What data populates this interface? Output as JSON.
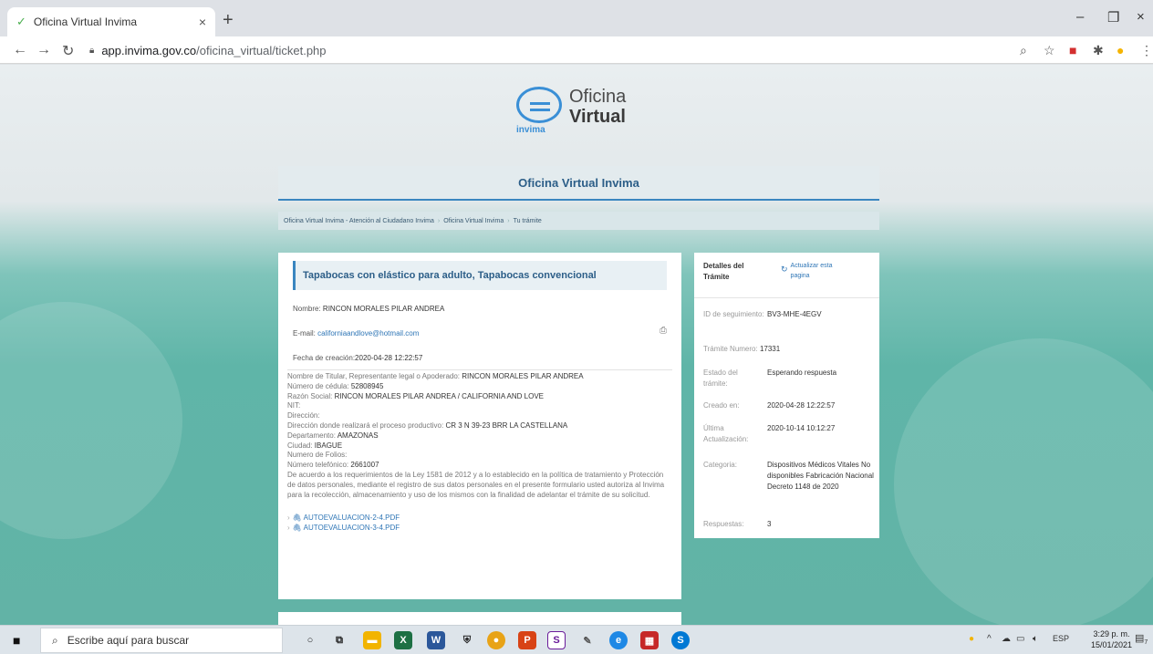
{
  "browser": {
    "tab_title": "Oficina Virtual Invima",
    "url_host": "app.invima.gov.co",
    "url_path": "/oficina_virtual/ticket.php"
  },
  "logo": {
    "brand": "invima",
    "line1": "Oficina",
    "line2": "Virtual"
  },
  "header": {
    "title": "Oficina Virtual Invima"
  },
  "breadcrumb": [
    "Oficina Virtual Invima - Atención al Ciudadano Invima",
    "Oficina Virtual Invima",
    "Tu trámite"
  ],
  "ticket": {
    "title": "Tapabocas con elástico para adulto, Tapabocas convencional",
    "nombre_label": "Nombre:",
    "nombre_value": "RINCON MORALES PILAR ANDREA",
    "email_label": "E-mail:",
    "email_value": "californiaandlove@hotmail.com",
    "fecha_label": "Fecha de creación:",
    "fecha_value": "2020-04-28 12:22:57",
    "details": [
      {
        "label": "Nombre de Titular, Representante legal o Apoderado: ",
        "value": "RINCON MORALES PILAR ANDREA"
      },
      {
        "label": "Número de cédula: ",
        "value": "52808945"
      },
      {
        "label": "Razón Social: ",
        "value": "RINCON MORALES PILAR ANDREA / CALIFORNIA AND LOVE"
      },
      {
        "label": "NIT:",
        "value": ""
      },
      {
        "label": "Dirección:",
        "value": ""
      },
      {
        "label": "Dirección donde realizará el proceso productivo: ",
        "value": "CR 3 N 39-23 BRR LA CASTELLANA"
      },
      {
        "label": "Departamento: ",
        "value": "AMAZONAS"
      },
      {
        "label": "Ciudad: ",
        "value": "IBAGUE"
      },
      {
        "label": "Numero de Folios:",
        "value": ""
      },
      {
        "label": "Número telefónico: ",
        "value": "2661007"
      }
    ],
    "legal": "De acuerdo a los requerimientos de la Ley 1581 de 2012 y a lo establecido en la política de tratamiento y Protección de datos personales, mediante el registro de sus datos personales en el presente formulario usted autoriza al Invima para la recolección, almacenamiento y uso de los mismos con la finalidad de adelantar el trámite de su solicitud.",
    "attachments": [
      "AUTOEVALUACION-2-4.PDF",
      "AUTOEVALUACION-3-4.PDF"
    ]
  },
  "side": {
    "heading": "Detalles del Trámite",
    "refresh": "Actualizar esta pagina",
    "id_label": "ID de seguimiento:",
    "id_value": "BV3-MHE-4EGV",
    "numero_label": "Trámite Numero:",
    "numero_value": "17331",
    "estado_label": "Estado del trámite:",
    "estado_value": "Esperando respuesta",
    "creado_label": "Creado en:",
    "creado_value": "2020-04-28 12:22:57",
    "ultima_label": "Última Actualización:",
    "ultima_value": "2020-10-14 10:12:27",
    "categoria_label": "Categoria:",
    "categoria_value": "Dispositivos Médicos Vitales No disponibles Fabricación Nacional Decreto 1148 de 2020",
    "respuestas_label": "Respuestas:",
    "respuestas_value": "3"
  },
  "taskbar": {
    "search_placeholder": "Escribe aquí para buscar",
    "lang": "ESP",
    "time": "3:29 p. m.",
    "date": "15/01/2021",
    "notif_count": "7"
  }
}
